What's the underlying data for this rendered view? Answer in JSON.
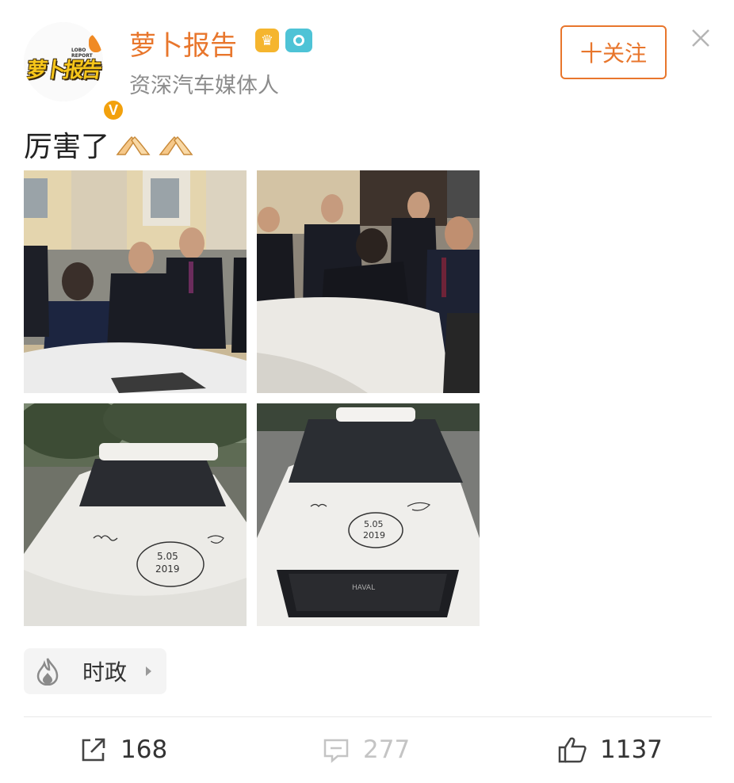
{
  "author": {
    "name": "萝卜报告",
    "description": "资深汽车媒体人",
    "avatar_logo_text": "萝卜报告",
    "avatar_logo_subtext": "LOBO REPORT",
    "verified_mark": "V",
    "badges": [
      "crown-badge-icon",
      "camera-badge-icon"
    ]
  },
  "follow_button": {
    "label": "十关注"
  },
  "post": {
    "text": "厉害了",
    "emojis": [
      "pray-hands-icon",
      "pray-hands-icon"
    ],
    "images": [
      {
        "plate_text": "",
        "signature": ""
      },
      {
        "plate_text": "",
        "signature": ""
      },
      {
        "hood_date_line1": "5.05",
        "hood_date_line2": "2019"
      },
      {
        "hood_date_line1": "5.05",
        "hood_date_line2": "2019",
        "grille_brand": "HAVAL"
      }
    ]
  },
  "topic": {
    "icon": "fire-icon",
    "label": "时政"
  },
  "actions": {
    "share_count": "168",
    "comment_count": "277",
    "like_count": "1137"
  },
  "colors": {
    "accent": "#e8762c",
    "verified": "#f2a10d",
    "muted_text": "#8c8c8c",
    "disabled": "#c4c4c4"
  }
}
